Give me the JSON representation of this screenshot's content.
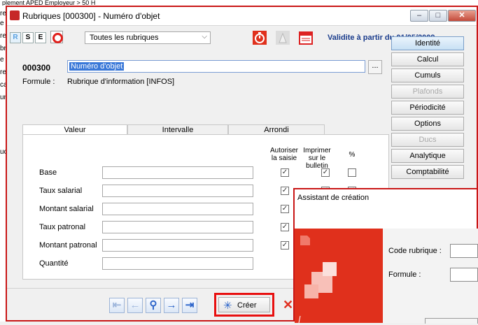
{
  "background_window": {
    "title_fragment": "plement APED Employeur > 50 H",
    "left_fragments": [
      "re",
      "e",
      "re",
      "br",
      "e",
      "re",
      "ca",
      "un",
      "uc"
    ]
  },
  "window": {
    "title": "Rubriques [000300] - Numéro d'objet",
    "controls": {
      "minimize": "–",
      "maximize": "□",
      "close": "✕"
    }
  },
  "toolbar": {
    "rse": [
      "R",
      "S",
      "E"
    ],
    "filter_selected": "Toutes les rubriques",
    "validite": "Validite à partir du 01/05/2009",
    "icons": [
      "stopwatch-icon",
      "cone-icon",
      "calendar-icon"
    ]
  },
  "header": {
    "code": "000300",
    "name_value": "Numéro d'objet",
    "formule_label": "Formule :",
    "formule_value": "Rubrique d'information [INFOS]",
    "dots": "..."
  },
  "side_buttons": [
    {
      "label": "Identité",
      "state": "active"
    },
    {
      "label": "Calcul",
      "state": "normal"
    },
    {
      "label": "Cumuls",
      "state": "normal"
    },
    {
      "label": "Plafonds",
      "state": "disabled"
    },
    {
      "label": "Périodicité",
      "state": "normal"
    },
    {
      "label": "Options",
      "state": "normal"
    },
    {
      "label": "Ducs",
      "state": "disabled"
    },
    {
      "label": "Analytique",
      "state": "normal"
    },
    {
      "label": "Comptabilité",
      "state": "normal"
    }
  ],
  "tabs": [
    "Valeur",
    "Intervalle",
    "Arrondi"
  ],
  "columns": {
    "autoriser": "Autoriser la saisie",
    "imprimer": "Imprimer sur le bulletin",
    "percent": "%"
  },
  "rows": [
    {
      "label": "Base",
      "autoriser": true,
      "imprimer": true,
      "percent": false
    },
    {
      "label": "Taux salarial",
      "autoriser": true,
      "imprimer": true,
      "percent": true
    },
    {
      "label": "Montant salarial",
      "autoriser": true,
      "imprimer": false,
      "percent": false
    },
    {
      "label": "Taux patronal",
      "autoriser": true,
      "imprimer": false,
      "percent": false
    },
    {
      "label": "Montant patronal",
      "autoriser": true,
      "imprimer": false,
      "percent": false
    },
    {
      "label": "Quantité",
      "autoriser": false,
      "imprimer": false,
      "percent": false
    }
  ],
  "navigation": {
    "buttons": [
      "first",
      "previous",
      "search",
      "next",
      "last"
    ],
    "creer_label": "Créer"
  },
  "wizard": {
    "title": "Assistant de création",
    "code_label": "Code rubrique :",
    "formule_label": "Formule :"
  },
  "colors": {
    "accent_red": "#e0301c",
    "highlight_red": "#e81010",
    "validite_blue": "#1a3c8c",
    "selection_blue": "#3a78d8"
  }
}
